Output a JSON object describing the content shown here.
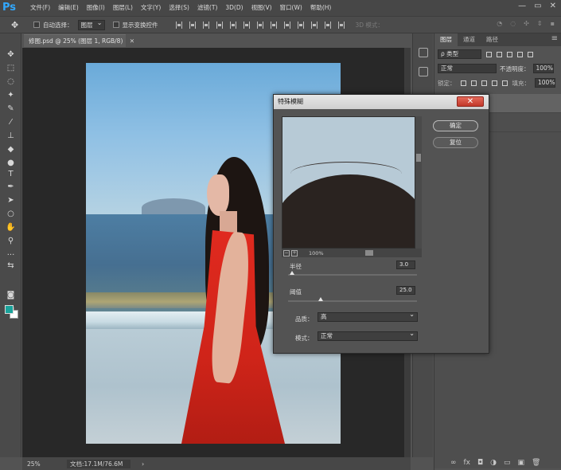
{
  "app": {
    "logo": "Ps"
  },
  "menu": {
    "items": [
      "文件(F)",
      "编辑(E)",
      "图像(I)",
      "图层(L)",
      "文字(Y)",
      "选择(S)",
      "滤镜(T)",
      "3D(D)",
      "视图(V)",
      "窗口(W)",
      "帮助(H)"
    ]
  },
  "window_controls": {
    "minimize": "—",
    "restore": "▭",
    "close": "✕"
  },
  "options": {
    "auto_select_label": "自动选择：",
    "auto_select_value": "图层",
    "show_transform_label": "显示变换控件",
    "mode_3d_label": "3D 模式："
  },
  "document": {
    "tab_title": "修图.psd @ 25% (图层 1, RGB/8)",
    "close": "✕"
  },
  "status": {
    "zoom": "25%",
    "doc_info": "文档:17.1M/76.6M",
    "arrow": "›"
  },
  "colors": {
    "foreground": "#1aa39b",
    "background": "#ffffff",
    "accent": "#31a8ff"
  },
  "layers_panel": {
    "tabs": [
      "图层",
      "通道",
      "路径"
    ],
    "menu_icon": "≡",
    "filter_kind": "ρ 类型",
    "blend_mode": "正常",
    "opacity_label": "不透明度：",
    "opacity_value": "100%",
    "lock_label": "锁定：",
    "fill_label": "填充：",
    "fill_value": "100%",
    "bottom_icons": [
      "∞",
      "fx",
      "◘",
      "◑",
      "▭",
      "▣",
      "🗑"
    ]
  },
  "dialog": {
    "title": "特殊模糊",
    "close": "✕",
    "ok": "确定",
    "reset": "复位",
    "zoom": "100%",
    "radius_label": "半径",
    "radius_value": "3.0",
    "radius_fraction": 0.03,
    "threshold_label": "阈值",
    "threshold_value": "25.0",
    "threshold_fraction": 0.25,
    "quality_label": "品质：",
    "quality_value": "高",
    "mode_label": "模式：",
    "mode_value": "正常",
    "zoom_out": "−",
    "zoom_in": "+"
  }
}
